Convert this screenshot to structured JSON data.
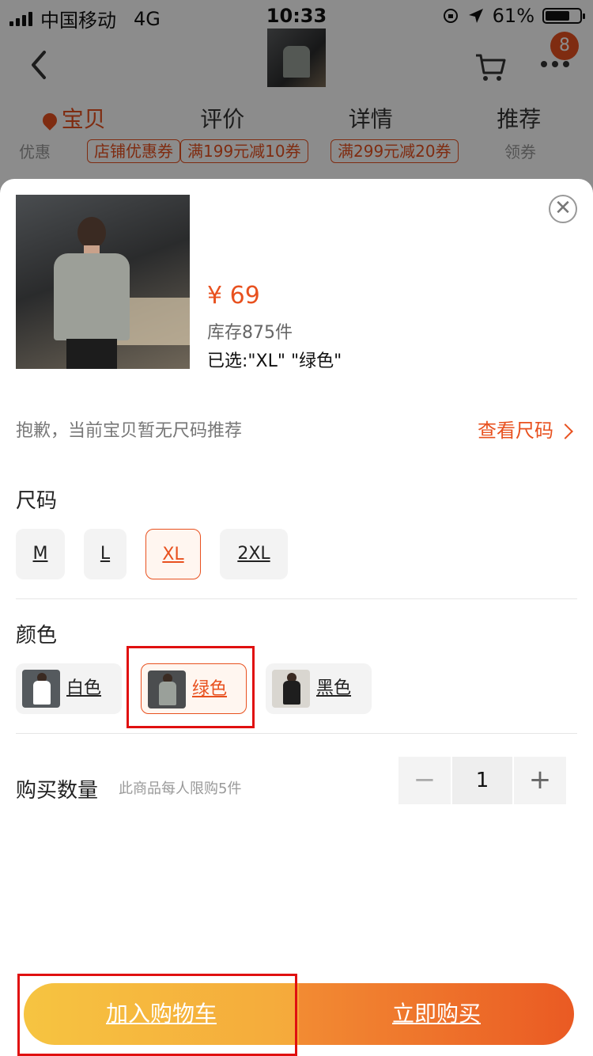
{
  "status_bar": {
    "carrier": "中国移动",
    "network": "4G",
    "time": "10:33",
    "battery": "61%"
  },
  "nav": {
    "badge_count": "8"
  },
  "tabs": [
    {
      "label": "宝贝"
    },
    {
      "label": "评价"
    },
    {
      "label": "详情"
    },
    {
      "label": "推荐"
    }
  ],
  "promo": {
    "label": "优惠",
    "coupons": [
      "店铺优惠券",
      "满199元减10券",
      "满299元减20券"
    ],
    "get": "领券"
  },
  "sheet": {
    "price": "¥ 69",
    "stock": "库存875件",
    "selected": "已选:\"XL\" \"绿色\"",
    "size_tip": "抱歉，当前宝贝暂无尺码推荐",
    "size_link": "查看尺码",
    "size_title": "尺码",
    "sizes": [
      {
        "label": "M"
      },
      {
        "label": "L"
      },
      {
        "label": "XL"
      },
      {
        "label": "2XL"
      }
    ],
    "color_title": "颜色",
    "colors": [
      {
        "label": "白色",
        "shirt": "#ffffff"
      },
      {
        "label": "绿色",
        "shirt": "#9aa09a"
      },
      {
        "label": "黑色",
        "shirt": "#1e1e1e"
      }
    ],
    "quantity_title": "购买数量",
    "quantity_limit": "此商品每人限购5件",
    "quantity": "1"
  },
  "actions": {
    "add_to_cart": "加入购物车",
    "buy_now": "立即购买"
  },
  "colors": {
    "accent": "#e8511f",
    "cart_button": "#f6c441",
    "buy_button": "#ea5a23",
    "highlight": "#e01010"
  }
}
